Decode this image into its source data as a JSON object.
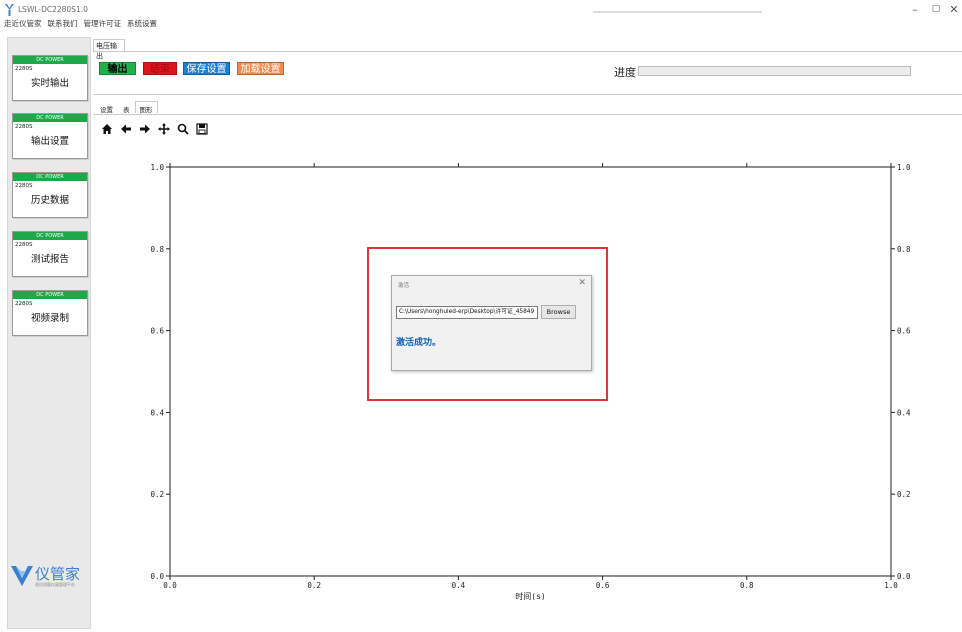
{
  "window": {
    "title": "LSWL-DC2280S1.0",
    "minimize_icon": "minimize-icon",
    "maximize_icon": "maximize-icon",
    "close_icon": "close-icon"
  },
  "menu": [
    "走近仪管家",
    "联系我们",
    "管理许可证",
    "系统设置"
  ],
  "sidebar": {
    "items": [
      {
        "badge": "DC POWER",
        "model": "2280S",
        "label": "实时输出"
      },
      {
        "badge": "DC POWER",
        "model": "2280S",
        "label": "输出设置"
      },
      {
        "badge": "DC POWER",
        "model": "2280S",
        "label": "历史数据"
      },
      {
        "badge": "DC POWER",
        "model": "2280S",
        "label": "测试报告"
      },
      {
        "badge": "DC POWER",
        "model": "2280S",
        "label": "视频录制"
      }
    ],
    "brand": "仪管家",
    "brand_sub": "测试测量仪器管理平台"
  },
  "main_tab": "电压输出",
  "toolbar": {
    "output_label": "输出",
    "stop_label": "结束",
    "save_label": "保存设置",
    "load_label": "加载设置"
  },
  "progress": {
    "label": "进度",
    "value": 0
  },
  "subtabs": [
    "设置",
    "表",
    "图形"
  ],
  "plot_tools": [
    "home-icon",
    "back-arrow-icon",
    "forward-arrow-icon",
    "pan-icon",
    "zoom-icon",
    "save-icon"
  ],
  "chart_data": {
    "type": "line",
    "xlabel": "时间(s)",
    "ylabel": "",
    "xlim": [
      0.0,
      1.0
    ],
    "ylim": [
      0.0,
      1.0
    ],
    "xticks": [
      "0.0",
      "0.2",
      "0.4",
      "0.6",
      "0.8",
      "1.0"
    ],
    "yticks": [
      "0.0",
      "0.2",
      "0.4",
      "0.6",
      "0.8",
      "1.0"
    ],
    "series": []
  },
  "dialog": {
    "title": "激活",
    "path": "C:\\Users\\honghuled-erp\\Desktop\\许可证_45849",
    "browse_label": "Browse",
    "message": "激活成功。"
  },
  "colors": {
    "output": "#20b24a",
    "stop": "#e0141e",
    "save": "#1d7fd6",
    "load": "#f58a4b",
    "highlight": "#e0353b",
    "success_text": "#1561b8"
  }
}
